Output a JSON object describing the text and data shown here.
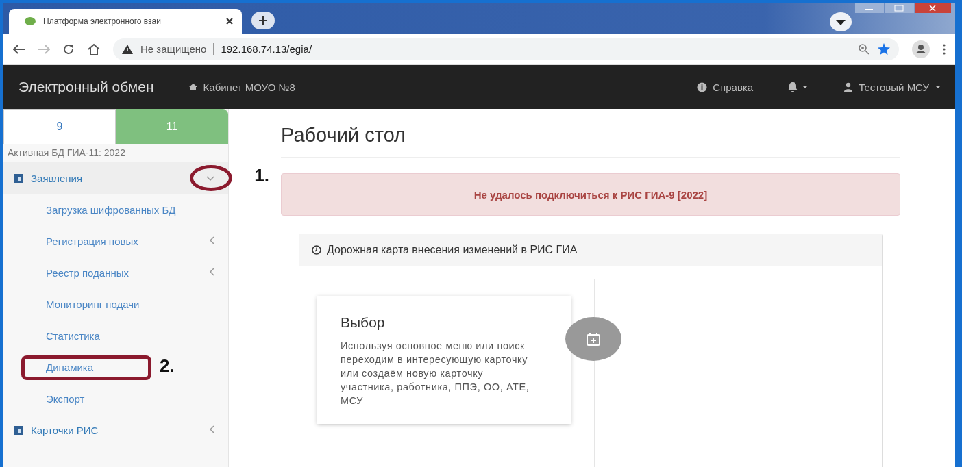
{
  "browser": {
    "tab": {
      "title": "Платформа электронного взаи"
    },
    "address": {
      "security": "Не защищено",
      "url": "192.168.74.13/egia/"
    }
  },
  "navbar": {
    "brand": "Электронный обмен",
    "cabinet": "Кабинет МОУО №8",
    "help": "Справка",
    "user": "Тестовый МСУ"
  },
  "sidebar": {
    "grade_tabs": [
      {
        "label": "9",
        "selected": false
      },
      {
        "label": "11",
        "selected": true
      }
    ],
    "active_db": "Активная БД ГИА-11: 2022",
    "sections": [
      {
        "label": "Заявления",
        "expanded": true,
        "annotation": "1.",
        "children": [
          {
            "label": "Загрузка шифрованных БД",
            "kind": "link"
          },
          {
            "label": "Регистрация новых",
            "kind": "submenu"
          },
          {
            "label": "Реестр поданных",
            "kind": "submenu"
          },
          {
            "label": "Мониторинг подачи",
            "kind": "link"
          },
          {
            "label": "Статистика",
            "kind": "link"
          },
          {
            "label": "Динамика",
            "kind": "link",
            "annotation": "2."
          },
          {
            "label": "Экспорт",
            "kind": "link"
          }
        ]
      },
      {
        "label": "Карточки РИС",
        "expanded": false
      }
    ]
  },
  "main": {
    "title": "Рабочий стол",
    "alert": "Не удалось подключиться к РИС ГИА-9 [2022]",
    "panel": {
      "heading": "Дорожная карта внесения изменений в РИС ГИА",
      "steps": [
        {
          "title": "Выбор",
          "text": "Используя основное меню или поиск переходим в интересующую карточку или создаём новую карточку участника, работника, ППЭ, ОО, АТЕ, МСУ"
        }
      ]
    }
  }
}
